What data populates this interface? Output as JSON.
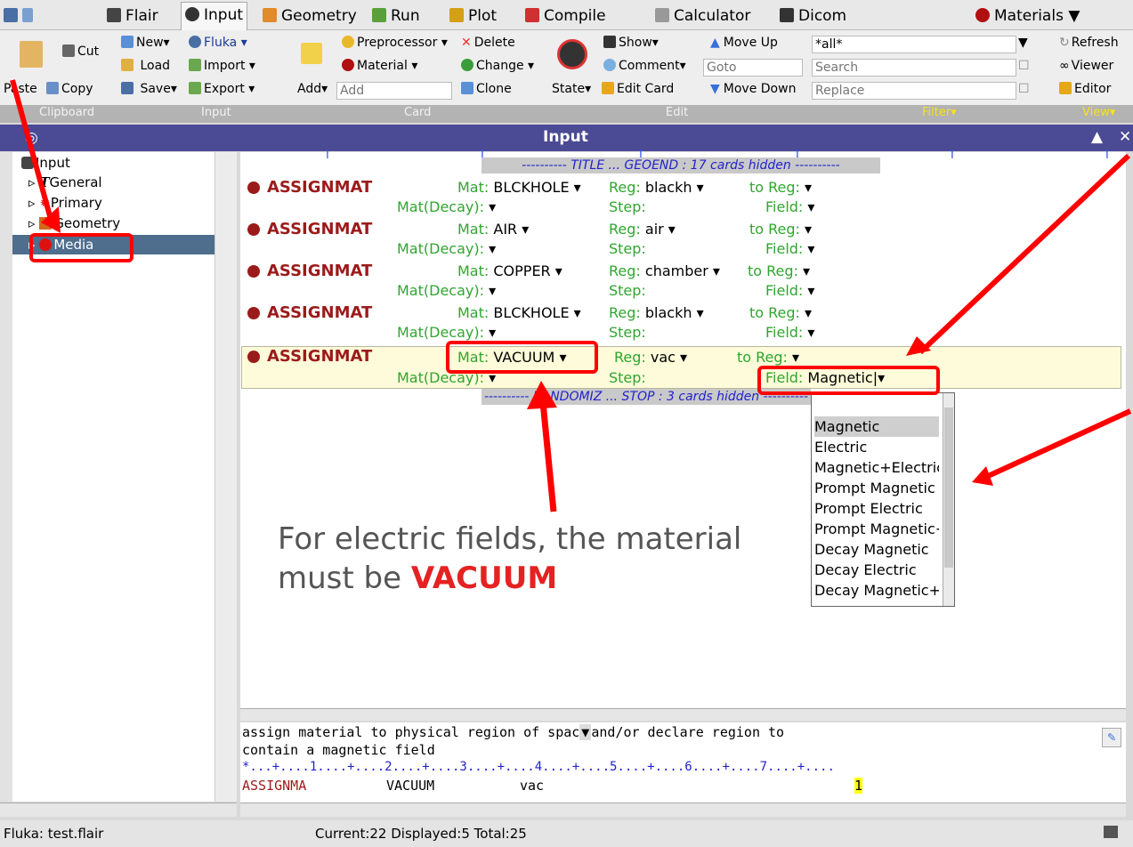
{
  "tabs": [
    {
      "label": "Flair"
    },
    {
      "label": "Input"
    },
    {
      "label": "Geometry"
    },
    {
      "label": "Run"
    },
    {
      "label": "Plot"
    },
    {
      "label": "Compile"
    },
    {
      "label": "Calculator"
    },
    {
      "label": "Dicom"
    },
    {
      "label": "Materials"
    }
  ],
  "ribbon": {
    "clipboard": {
      "cut": "Cut",
      "paste": "Paste",
      "copy": "Copy"
    },
    "input": {
      "new": "New",
      "fluka": "Fluka",
      "load": "Load",
      "import": "Import",
      "save": "Save",
      "export": "Export"
    },
    "card": {
      "preprocessor": "Preprocessor",
      "delete": "Delete",
      "material": "Material",
      "change": "Change",
      "add": "Add",
      "add_placeholder": "Add",
      "clone": "Clone"
    },
    "edit": {
      "show": "Show",
      "move_up": "Move Up",
      "comment": "Comment",
      "goto_placeholder": "Goto",
      "state": "State",
      "edit_card": "Edit Card",
      "move_down": "Move Down"
    },
    "filter": {
      "value": "*all*",
      "search_placeholder": "Search",
      "replace_placeholder": "Replace"
    },
    "view": {
      "refresh": "Refresh",
      "viewer": "Viewer",
      "editor": "Editor"
    }
  },
  "groups": [
    {
      "label": "Clipboard"
    },
    {
      "label": "Input"
    },
    {
      "label": "Card"
    },
    {
      "label": "Edit"
    },
    {
      "label": "Filter"
    },
    {
      "label": "View"
    }
  ],
  "window": {
    "title": "Input"
  },
  "tree": {
    "items": [
      {
        "label": "Input"
      },
      {
        "label": "General"
      },
      {
        "label": "Primary"
      },
      {
        "label": "Geometry"
      },
      {
        "label": "Media"
      }
    ]
  },
  "separators": {
    "top": "---------- TITLE ... GEOEND : 17 cards hidden ----------",
    "bottom": "---------- RANDOMIZ ... STOP : 3 cards hidden ----------"
  },
  "cards": [
    {
      "name": "ASSIGNMAT",
      "mat": "BLCKHOLE",
      "reg": "blackh",
      "to_reg": "",
      "mat_decay": "",
      "step": "",
      "field": ""
    },
    {
      "name": "ASSIGNMAT",
      "mat": "AIR",
      "reg": "air",
      "to_reg": "",
      "mat_decay": "",
      "step": "",
      "field": ""
    },
    {
      "name": "ASSIGNMAT",
      "mat": "COPPER",
      "reg": "chamber",
      "to_reg": "",
      "mat_decay": "",
      "step": "",
      "field": ""
    },
    {
      "name": "ASSIGNMAT",
      "mat": "BLCKHOLE",
      "reg": "blackh",
      "to_reg": "",
      "mat_decay": "",
      "step": "",
      "field": ""
    },
    {
      "name": "ASSIGNMAT",
      "mat": "VACUUM",
      "reg": "vac",
      "to_reg": "",
      "mat_decay": "",
      "step": "",
      "field": "Magnetic"
    }
  ],
  "labels": {
    "mat": "Mat:",
    "reg": "Reg:",
    "to_reg": "to Reg:",
    "mat_decay": "Mat(Decay):",
    "step": "Step:",
    "field": "Field:"
  },
  "dropdown_options": [
    "Magnetic",
    "Electric",
    "Magnetic+Electric",
    "Prompt Magnetic",
    "Prompt Electric",
    "Prompt Magnetic+Electric",
    "Decay Magnetic",
    "Decay Electric",
    "Decay Magnetic+Electric"
  ],
  "annotation": {
    "line1": "For electric fields, the material",
    "line2_prefix": "must be ",
    "line2_emphasis": "VACUUM"
  },
  "help": {
    "line1": "assign material to physical region of spac",
    "line1_tail": "and/or declare region to",
    "line2": "contain a magnetic field",
    "ruler": "*...+....1....+....2....+....3....+....4....+....5....+....6....+....7....+....",
    "card_keyword": "ASSIGNMA",
    "card_mat": "VACUUM",
    "card_reg": "vac",
    "card_field_value": "1"
  },
  "status": {
    "file": "Fluka: test.flair",
    "counts": "Current:22  Displayed:5 Total:25"
  },
  "colors": {
    "accent": "#4b4a95",
    "card_name": "#9b1b1b",
    "label_green": "#2fa62f",
    "annotation_red": "#ff0000"
  }
}
